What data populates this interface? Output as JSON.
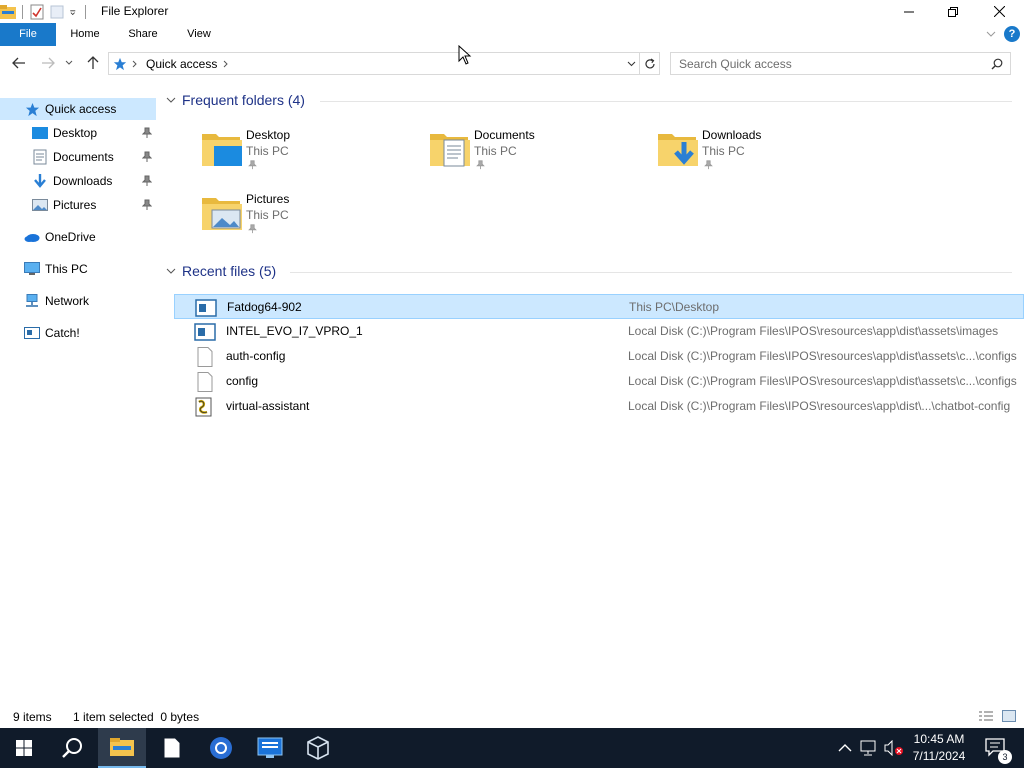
{
  "window": {
    "title": "File Explorer"
  },
  "ribbon": {
    "tabs": [
      "File",
      "Home",
      "Share",
      "View"
    ]
  },
  "address": {
    "breadcrumb": "Quick access"
  },
  "search": {
    "placeholder": "Search Quick access"
  },
  "navpane": {
    "items": [
      {
        "label": "Quick access",
        "icon": "star-icon",
        "selected": true,
        "pinned": false
      },
      {
        "label": "Desktop",
        "icon": "desktop-icon",
        "selected": false,
        "pinned": true
      },
      {
        "label": "Documents",
        "icon": "documents-icon",
        "selected": false,
        "pinned": true
      },
      {
        "label": "Downloads",
        "icon": "download-arrow-icon",
        "selected": false,
        "pinned": true
      },
      {
        "label": "Pictures",
        "icon": "pictures-icon",
        "selected": false,
        "pinned": true
      },
      {
        "label": "OneDrive",
        "icon": "cloud-icon",
        "selected": false,
        "pinned": false
      },
      {
        "label": "This PC",
        "icon": "computer-icon",
        "selected": false,
        "pinned": false
      },
      {
        "label": "Network",
        "icon": "network-icon",
        "selected": false,
        "pinned": false
      },
      {
        "label": "Catch!",
        "icon": "catch-icon",
        "selected": false,
        "pinned": false
      }
    ]
  },
  "frequent": {
    "header": "Frequent folders (4)",
    "folders": [
      {
        "name": "Desktop",
        "location": "This PC",
        "icon": "desktop-folder-icon"
      },
      {
        "name": "Documents",
        "location": "This PC",
        "icon": "documents-folder-icon"
      },
      {
        "name": "Downloads",
        "location": "This PC",
        "icon": "downloads-folder-icon"
      },
      {
        "name": "Pictures",
        "location": "This PC",
        "icon": "pictures-folder-icon"
      }
    ]
  },
  "recent": {
    "header": "Recent files (5)",
    "files": [
      {
        "name": "Fatdog64-902",
        "path": "This PC\\Desktop",
        "icon": "app-window-icon",
        "selected": true
      },
      {
        "name": "INTEL_EVO_I7_VPRO_1",
        "path": "Local Disk (C:)\\Program Files\\IPOS\\resources\\app\\dist\\assets\\images",
        "icon": "app-window-icon",
        "selected": false
      },
      {
        "name": "auth-config",
        "path": "Local Disk (C:)\\Program Files\\IPOS\\resources\\app\\dist\\assets\\c...\\configs",
        "icon": "blank-file-icon",
        "selected": false
      },
      {
        "name": "config",
        "path": "Local Disk (C:)\\Program Files\\IPOS\\resources\\app\\dist\\assets\\c...\\configs",
        "icon": "blank-file-icon",
        "selected": false
      },
      {
        "name": "virtual-assistant",
        "path": "Local Disk (C:)\\Program Files\\IPOS\\resources\\app\\dist\\...\\chatbot-config",
        "icon": "script-file-icon",
        "selected": false
      }
    ]
  },
  "status": {
    "items": "9 items",
    "selection": "1 item selected  0 bytes"
  },
  "taskbar": {
    "time": "10:45 AM",
    "date": "7/11/2024",
    "notifications": "3"
  },
  "colors": {
    "accent": "#1979ca",
    "selection": "#cce8ff",
    "taskbar": "#101b2a"
  }
}
